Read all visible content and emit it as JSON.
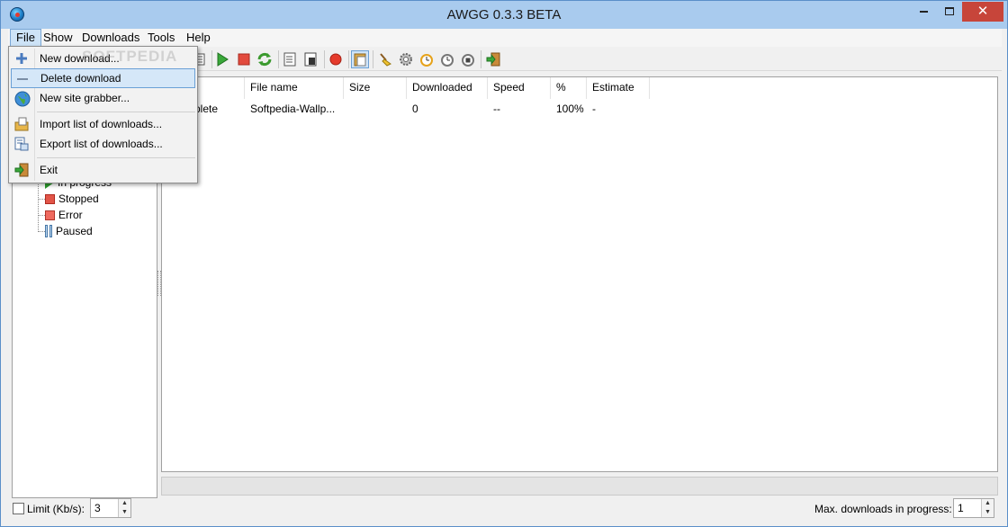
{
  "window": {
    "title": "AWGG 0.3.3 BETA",
    "close_glyph": "✕"
  },
  "menubar": {
    "items": [
      "File",
      "Show",
      "Downloads",
      "Tools",
      "Help"
    ]
  },
  "file_menu": {
    "items": [
      {
        "label": "New download...",
        "icon": "plus-icon"
      },
      {
        "label": "Delete download",
        "icon": "minus-icon",
        "highlighted": true
      },
      {
        "label": "New site grabber...",
        "icon": "globe-icon"
      },
      {
        "label": "Import list of downloads...",
        "icon": "import-icon"
      },
      {
        "label": "Export list of downloads...",
        "icon": "export-icon"
      },
      {
        "label": "Exit",
        "icon": "exit-icon"
      }
    ]
  },
  "toolbar": {
    "icons": [
      "queue-icon",
      "start-icon",
      "stop-icon",
      "restart-icon",
      "properties-icon",
      "open-folder-icon",
      "record-icon",
      "clipboard-icon",
      "clean-icon",
      "settings-icon",
      "scheduler-start-icon",
      "scheduler-icon",
      "scheduler-stop-icon",
      "exit-icon"
    ]
  },
  "tree": {
    "items": [
      {
        "label": "In progress",
        "icon": "play-icon"
      },
      {
        "label": "Stopped",
        "icon": "stop-icon"
      },
      {
        "label": "Error",
        "icon": "error-icon"
      },
      {
        "label": "Paused",
        "icon": "pause-icon"
      }
    ]
  },
  "list": {
    "columns": [
      "File name",
      "Size",
      "Downloaded",
      "Speed",
      "%",
      "Estimate"
    ],
    "rows": [
      {
        "status": "mplete",
        "file_name": "Softpedia-Wallp...",
        "size": "",
        "downloaded": "0",
        "speed": "--",
        "percent": "100%",
        "estimate": "-"
      }
    ]
  },
  "statusbar": {
    "limit_label": "Limit (Kb/s):",
    "limit_value": "3",
    "limit_checked": false,
    "max_label": "Max. downloads in progress:",
    "max_value": "1"
  },
  "watermark": "SOFTPEDIA"
}
